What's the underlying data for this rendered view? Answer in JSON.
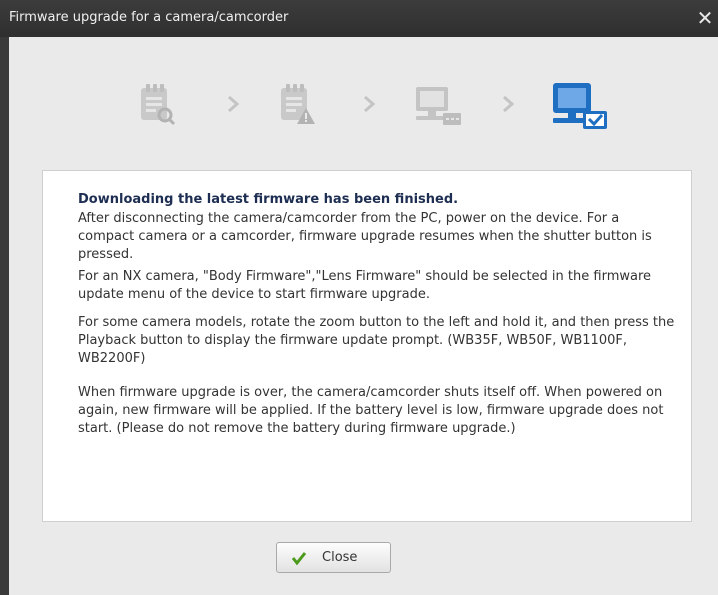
{
  "window": {
    "title": "Firmware upgrade for a camera/camcorder",
    "close_glyph": "✕"
  },
  "steps": [
    {
      "icon": "document-search-icon",
      "state": "inactive"
    },
    {
      "icon": "document-warning-icon",
      "state": "inactive"
    },
    {
      "icon": "computer-transfer-icon",
      "state": "inactive"
    },
    {
      "icon": "computer-check-icon",
      "state": "active"
    }
  ],
  "colors": {
    "active_step": "#1e6fc2",
    "inactive_step": "#c4c4c4",
    "check": "#4c9a1c",
    "heading": "#1d2e52"
  },
  "message": {
    "heading": "Downloading the latest firmware has been finished.",
    "p1": "After disconnecting the camera/camcorder from the PC, power on the device. For a compact camera or a camcorder, firmware upgrade resumes when the shutter button is pressed.",
    "p2": "For an NX camera, \"Body Firmware\",\"Lens Firmware\" should be selected in the firmware update menu of the device to start firmware upgrade.",
    "p3": "For some camera models, rotate the zoom button to the left and hold it, and then press the Playback button to display the firmware update prompt. (WB35F, WB50F, WB1100F, WB2200F)",
    "p4": "When firmware upgrade is over, the camera/camcorder shuts itself off.  When powered on again, new firmware will be applied. If the battery level is low, firmware upgrade does not start. (Please do not remove the battery during firmware upgrade.)"
  },
  "buttons": {
    "close_label": "Close"
  }
}
